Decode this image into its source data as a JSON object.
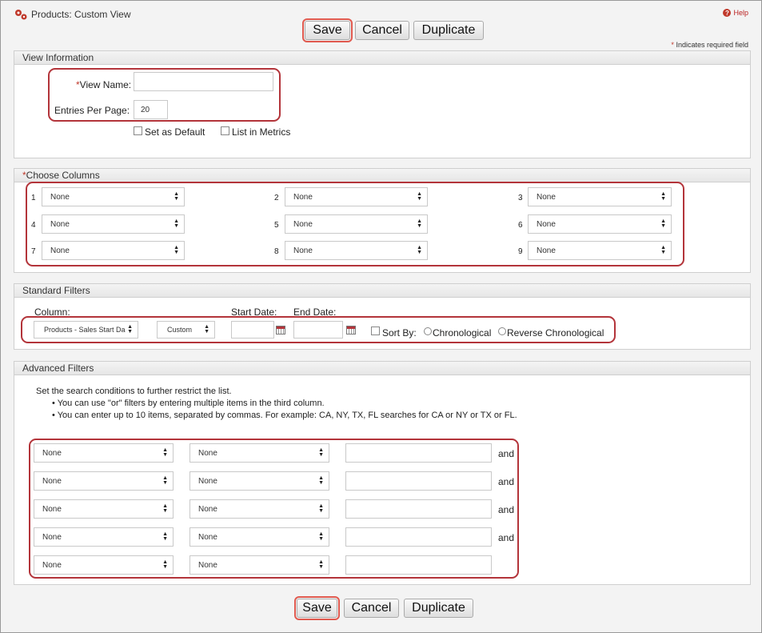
{
  "header": {
    "title": "Products: Custom View",
    "help_label": "Help",
    "required_note": "Indicates required field"
  },
  "buttons": {
    "save": "Save",
    "cancel": "Cancel",
    "duplicate": "Duplicate"
  },
  "view_info": {
    "section_title": "View Information",
    "view_name_label": "View Name:",
    "view_name_value": "",
    "entries_label": "Entries Per Page:",
    "entries_value": "20",
    "set_default_label": "Set as Default",
    "list_metrics_label": "List in Metrics"
  },
  "choose_columns": {
    "section_title": "Choose Columns",
    "columns": [
      {
        "num": "1",
        "value": "None"
      },
      {
        "num": "2",
        "value": "None"
      },
      {
        "num": "3",
        "value": "None"
      },
      {
        "num": "4",
        "value": "None"
      },
      {
        "num": "5",
        "value": "None"
      },
      {
        "num": "6",
        "value": "None"
      },
      {
        "num": "7",
        "value": "None"
      },
      {
        "num": "8",
        "value": "None"
      },
      {
        "num": "9",
        "value": "None"
      }
    ]
  },
  "standard_filters": {
    "section_title": "Standard Filters",
    "column_label": "Column:",
    "column_value": "Products - Sales Start Da",
    "range_value": "Custom",
    "start_label": "Start Date:",
    "end_label": "End Date:",
    "sort_label": "Sort By:",
    "chrono_label": "Chronological",
    "reverse_label": "Reverse Chronological"
  },
  "advanced_filters": {
    "section_title": "Advanced Filters",
    "intro": "Set the search conditions to further restrict the list.",
    "bullet1": "You can use \"or\" filters by entering multiple items in the third column.",
    "bullet2": "You can enter up to 10 items, separated by commas. For example: CA, NY, TX, FL searches for CA or NY or TX or FL.",
    "rows": [
      {
        "field": "None",
        "op": "None",
        "joiner": "and"
      },
      {
        "field": "None",
        "op": "None",
        "joiner": "and"
      },
      {
        "field": "None",
        "op": "None",
        "joiner": "and"
      },
      {
        "field": "None",
        "op": "None",
        "joiner": "and"
      },
      {
        "field": "None",
        "op": "None",
        "joiner": ""
      }
    ]
  },
  "colors": {
    "accent_red": "#b3343a",
    "highlight": "#e05a4f"
  }
}
